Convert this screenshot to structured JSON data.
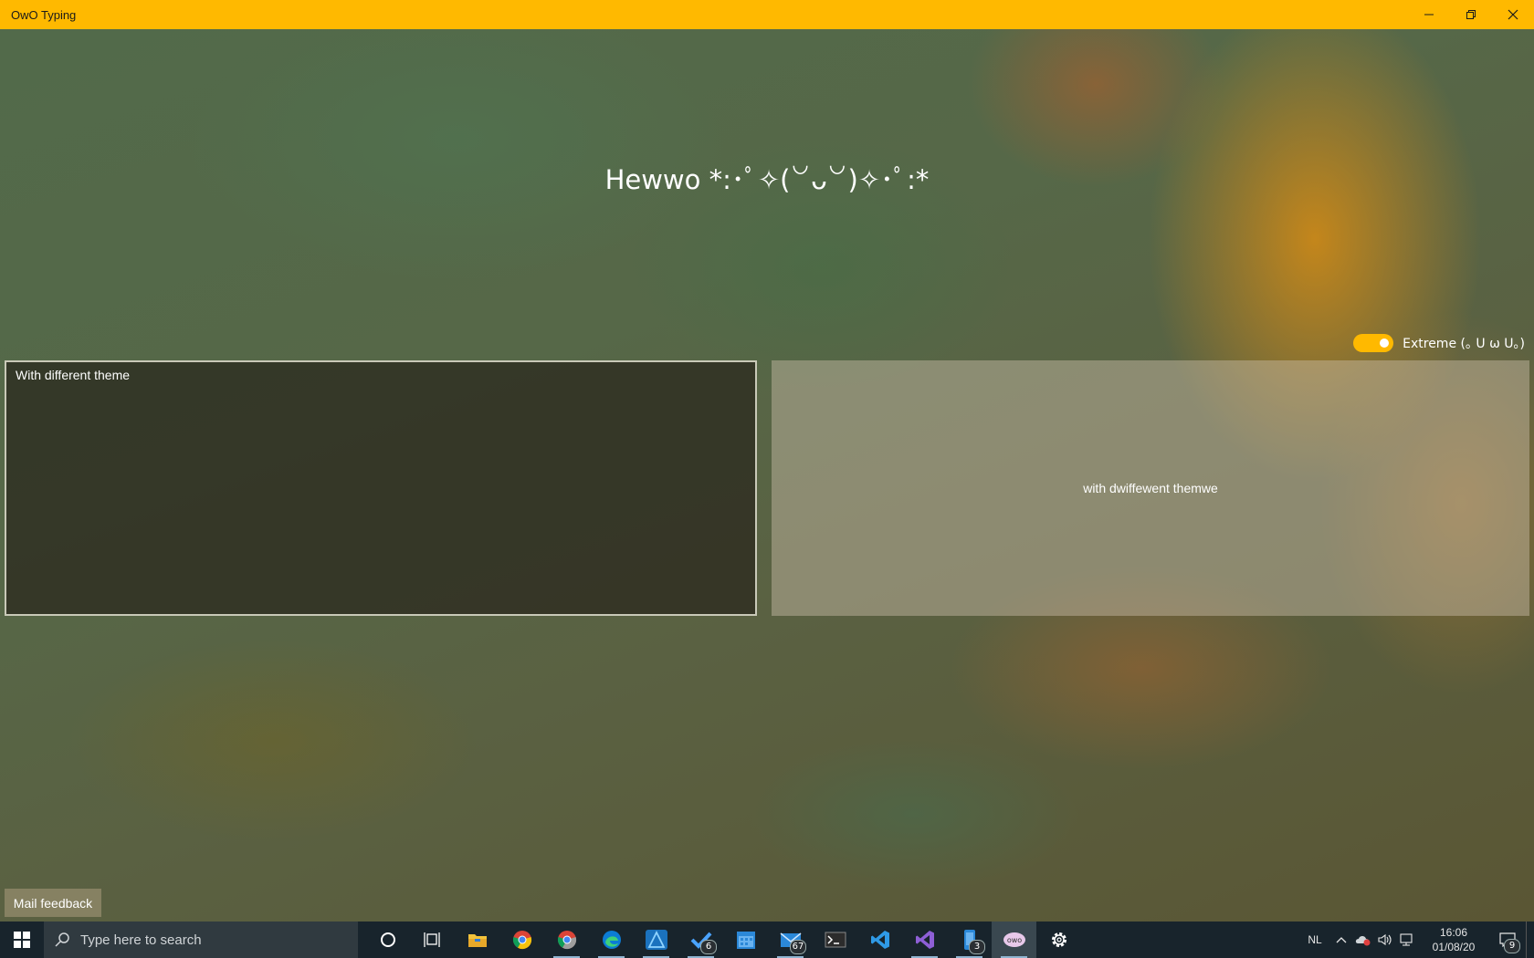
{
  "window": {
    "title": "OwO Typing",
    "accent": "#ffb900"
  },
  "main": {
    "headline": "Hewwo *:･ﾟ✧(꒡ᴗ꒡)✧･ﾟ:*",
    "extreme_toggle": {
      "label": "Extreme (｡ U ω U｡)",
      "on": true
    },
    "input_text": "With different theme",
    "output_text": "with dwiffewent themwe",
    "feedback_button": "Mail feedback"
  },
  "taskbar": {
    "search_placeholder": "Type here to search",
    "apps": [
      {
        "name": "cortana-icon"
      },
      {
        "name": "task-view-icon"
      },
      {
        "name": "file-explorer-icon"
      },
      {
        "name": "chrome-icon"
      },
      {
        "name": "chrome-dev-icon"
      },
      {
        "name": "edge-icon"
      },
      {
        "name": "affinity-designer-icon"
      },
      {
        "name": "todo-icon",
        "badge": "6"
      },
      {
        "name": "calendar-icon"
      },
      {
        "name": "mail-icon",
        "badge": "67"
      },
      {
        "name": "terminal-icon"
      },
      {
        "name": "vscode-icon"
      },
      {
        "name": "visual-studio-icon"
      },
      {
        "name": "phone-icon",
        "badge": "3"
      },
      {
        "name": "owo-typing-icon",
        "active": true
      },
      {
        "name": "settings-icon"
      }
    ],
    "tray": {
      "language": "NL",
      "time": "16:06",
      "date": "01/08/20",
      "notification_count": "9"
    }
  }
}
